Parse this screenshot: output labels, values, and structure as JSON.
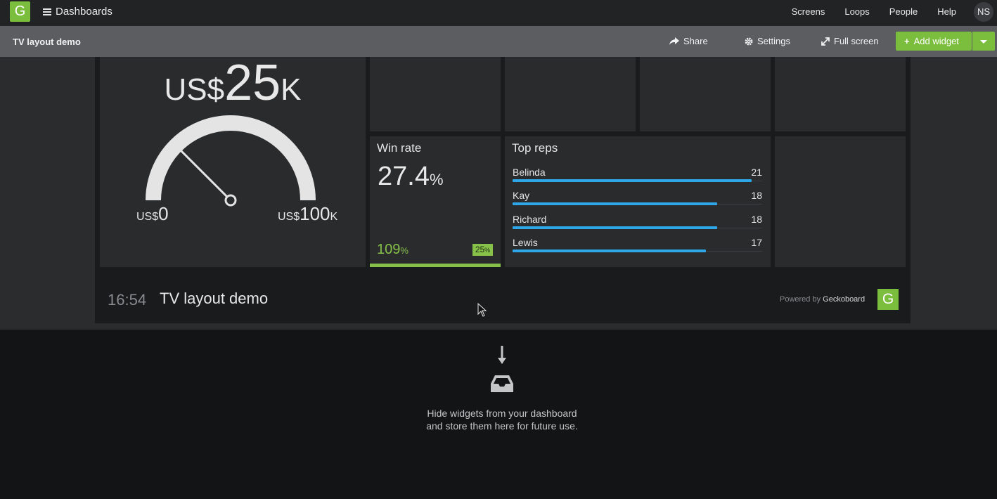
{
  "topnav": {
    "logo_letter": "G",
    "dashboards_label": "Dashboards",
    "links": [
      "Screens",
      "Loops",
      "People",
      "Help"
    ],
    "avatar_initials": "NS"
  },
  "header": {
    "dashboard_title": "TV layout demo",
    "share_label": "Share",
    "settings_label": "Settings",
    "fullscreen_label": "Full screen",
    "add_widget_label": "Add widget"
  },
  "widgets": {
    "gauge": {
      "prefix": "US$",
      "value": "25",
      "suffix": "K",
      "value_fraction": 0.25,
      "min_prefix": "US$",
      "min": "0",
      "max_prefix": "US$",
      "max": "100",
      "max_suffix": "K"
    },
    "win_rate": {
      "title": "Win rate",
      "value": "27.4",
      "unit": "%",
      "comparison": "109",
      "comparison_unit": "%",
      "badge": "25",
      "badge_unit": "%"
    },
    "top_reps": {
      "title": "Top reps",
      "max": 21,
      "reps": [
        {
          "name": "Belinda",
          "value": "21",
          "n": 21
        },
        {
          "name": "Kay",
          "value": "18",
          "n": 18
        },
        {
          "name": "Richard",
          "value": "18",
          "n": 18
        },
        {
          "name": "Lewis",
          "value": "17",
          "n": 17
        }
      ]
    }
  },
  "footer": {
    "time": "16:54",
    "title": "TV layout demo",
    "powered_by": "Powered by",
    "brand": "Geckoboard",
    "logo_letter": "G"
  },
  "tray": {
    "line1": "Hide widgets from your dashboard",
    "line2": "and store them here for future use."
  },
  "colors": {
    "brand_green": "#7bbd3c",
    "positive_green": "#86c24a",
    "bar_blue": "#2ea7e8"
  }
}
